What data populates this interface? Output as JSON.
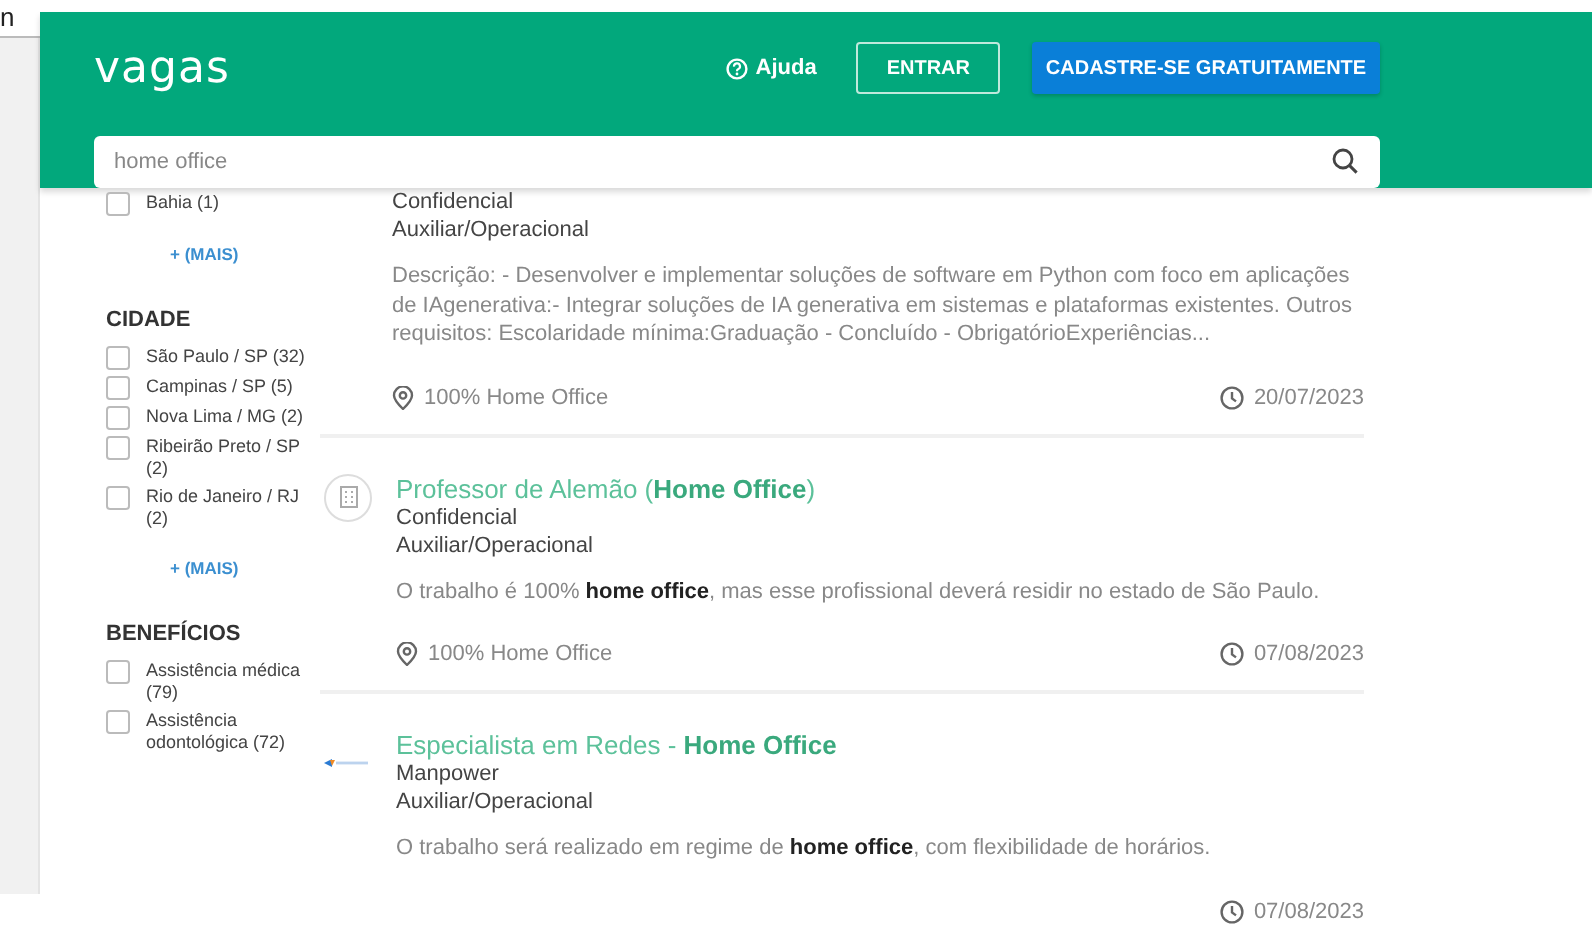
{
  "edge_text": "n",
  "header": {
    "logo": "vagas",
    "help": "Ajuda",
    "login": "ENTRAR",
    "signup": "CADASTRE-SE GRATUITAMENTE",
    "search": {
      "value": "home office"
    }
  },
  "filters": [
    {
      "items": [
        {
          "label": "Bahia (1)",
          "checked": false
        }
      ],
      "more": "+ (MAIS)"
    },
    {
      "title": "CIDADE",
      "items": [
        {
          "label": "São Paulo / SP (32)",
          "checked": false
        },
        {
          "label": "Campinas / SP (5)",
          "checked": false
        },
        {
          "label": "Nova Lima / MG (2)",
          "checked": false
        },
        {
          "label": "Ribeirão Preto / SP (2)",
          "checked": false
        },
        {
          "label": "Rio de Janeiro / RJ (2)",
          "checked": false
        }
      ],
      "more": "+ (MAIS)"
    },
    {
      "title": "BENEFÍCIOS",
      "items": [
        {
          "label": "Assistência médica (79)",
          "checked": false
        },
        {
          "label": "Assistência odontológica (72)",
          "checked": false
        }
      ]
    }
  ],
  "jobs": [
    {
      "kind": "none",
      "company": "Confidencial",
      "level": "Auxiliar/Operacional",
      "description": "Descrição: - Desenvolver e implementar soluções de software em Python com foco em aplicações de IAgenerativa:- Integrar soluções de IA generativa em sistemas e plataformas existentes. Outros requisitos: Escolaridade mínima:Graduação - Concluído - ObrigatórioExperiências...",
      "location": "100% Home Office",
      "date": "20/07/2023"
    },
    {
      "kind": "building",
      "title": "Professor de Alemão (**Home Office**)",
      "company": "Confidencial",
      "level": "Auxiliar/Operacional",
      "description": "O trabalho é 100% **home office**, mas esse profissional deverá residir no estado de São Paulo.",
      "location": "100% Home Office",
      "date": "07/08/2023"
    },
    {
      "kind": "brand",
      "title": "Especialista em Redes - **Home Office**",
      "company": "Manpower",
      "level": "Auxiliar/Operacional",
      "description": "O trabalho será realizado em regime de **home office**, com flexibilidade de horários.",
      "date": "07/08/2023"
    }
  ]
}
